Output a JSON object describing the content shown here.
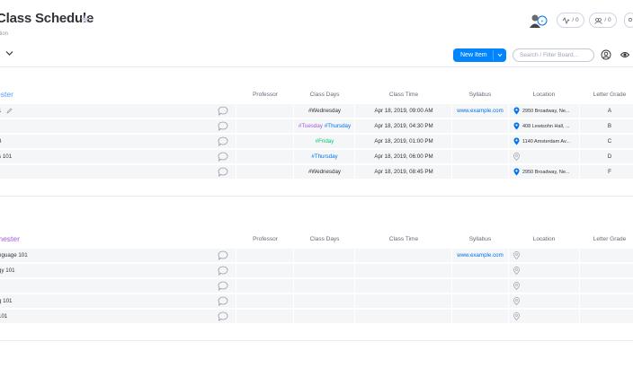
{
  "board": {
    "title": "Class Schedule",
    "description": "ption",
    "view_label": "n"
  },
  "header": {
    "activity_count": "/ 0",
    "updates_count": "/ 0",
    "new_item_label": "New Item",
    "search_placeholder": "Search / Filter Board..."
  },
  "columns": {
    "professor": "Professor",
    "class_days": "Class Days",
    "class_time": "Class Time",
    "syllabus": "Syllabus",
    "location": "Location",
    "letter_grade": "Letter Grade"
  },
  "groups": [
    {
      "name": "ester",
      "color": "#579bfc",
      "rows": [
        {
          "name": "1",
          "days": [
            {
              "text": "#Wednesday",
              "color": "#323338"
            }
          ],
          "time": "Apr 18, 2019, 09:00 AM",
          "syllabus": "www.example.com",
          "location": "2950 Broadway, Ne...",
          "grade": "A"
        },
        {
          "name": "",
          "days": [
            {
              "text": "#Tuesday",
              "color": "#a25ddc"
            },
            {
              "text": "#Thursday",
              "color": "#0073ea"
            }
          ],
          "time": "Apr 18, 2019, 04:30 PM",
          "syllabus": "",
          "location": "408 Lewisohn Hall, ...",
          "grade": "B"
        },
        {
          "name": "3",
          "days": [
            {
              "text": "#Friday",
              "color": "#00c875"
            }
          ],
          "time": "Apr 18, 2019, 01:00 PM",
          "syllabus": "",
          "location": "1140 Amsterdam Av...",
          "grade": "C"
        },
        {
          "name": "s 101",
          "days": [
            {
              "text": "#Thursday",
              "color": "#0073ea"
            }
          ],
          "time": "Apr 18, 2019, 06:00 PM",
          "syllabus": "",
          "location": "",
          "grade": "D"
        },
        {
          "name": "",
          "days": [
            {
              "text": "#Wednesday",
              "color": "#323338"
            }
          ],
          "time": "Apr 18, 2019, 08:45 PM",
          "syllabus": "",
          "location": "2950 Broadway, Ne...",
          "grade": "F"
        }
      ]
    },
    {
      "name": "mester",
      "color": "#a25ddc",
      "rows": [
        {
          "name": "nguage 101",
          "days": [],
          "time": "",
          "syllabus": "www.example.com",
          "location": "",
          "grade": ""
        },
        {
          "name": "gy 101",
          "days": [],
          "time": "",
          "syllabus": "",
          "location": "",
          "grade": ""
        },
        {
          "name": "",
          "days": [],
          "time": "",
          "syllabus": "",
          "location": "",
          "grade": ""
        },
        {
          "name": "g 101",
          "days": [],
          "time": "",
          "syllabus": "",
          "location": "",
          "grade": ""
        },
        {
          "name": "101",
          "days": [],
          "time": "",
          "syllabus": "",
          "location": "",
          "grade": ""
        }
      ]
    }
  ]
}
